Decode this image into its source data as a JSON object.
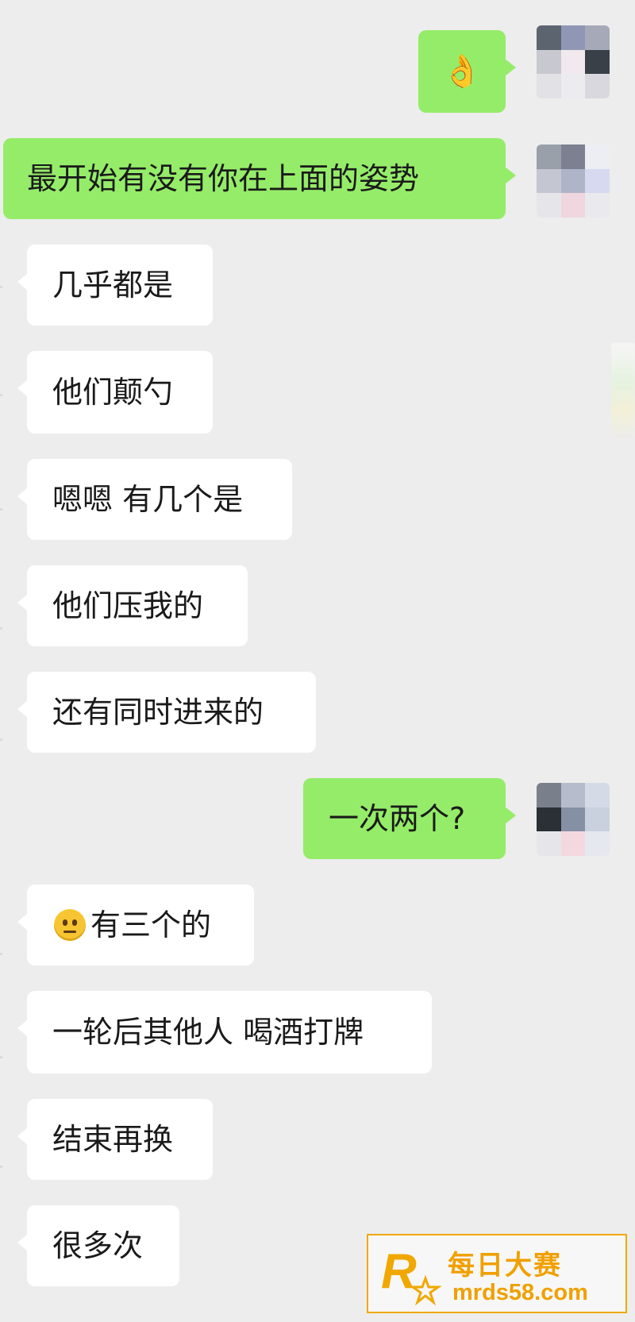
{
  "messages": [
    {
      "side": "out",
      "text": "👌"
    },
    {
      "side": "out",
      "text": "最开始有没有你在上面的姿势"
    },
    {
      "side": "in",
      "text": "几乎都是"
    },
    {
      "side": "in",
      "text": "他们颠勺"
    },
    {
      "side": "in",
      "text": "嗯嗯 有几个是"
    },
    {
      "side": "in",
      "text": "他们压我的"
    },
    {
      "side": "in",
      "text": "还有同时进来的"
    },
    {
      "side": "out",
      "text": "一次两个?"
    },
    {
      "side": "in",
      "text": "有三个的",
      "emoji": "neutral-face-emoji"
    },
    {
      "side": "in",
      "text": "一轮后其他人 喝酒打牌"
    },
    {
      "side": "in",
      "text": "结束再换"
    },
    {
      "side": "in",
      "text": "很多次"
    }
  ],
  "watermark": {
    "title": "每日大赛",
    "url": "mrds58.com",
    "color": "#f0a000"
  },
  "colors": {
    "background": "#ededed",
    "incoming_bubble": "#ffffff",
    "outgoing_bubble": "#95ec69"
  }
}
